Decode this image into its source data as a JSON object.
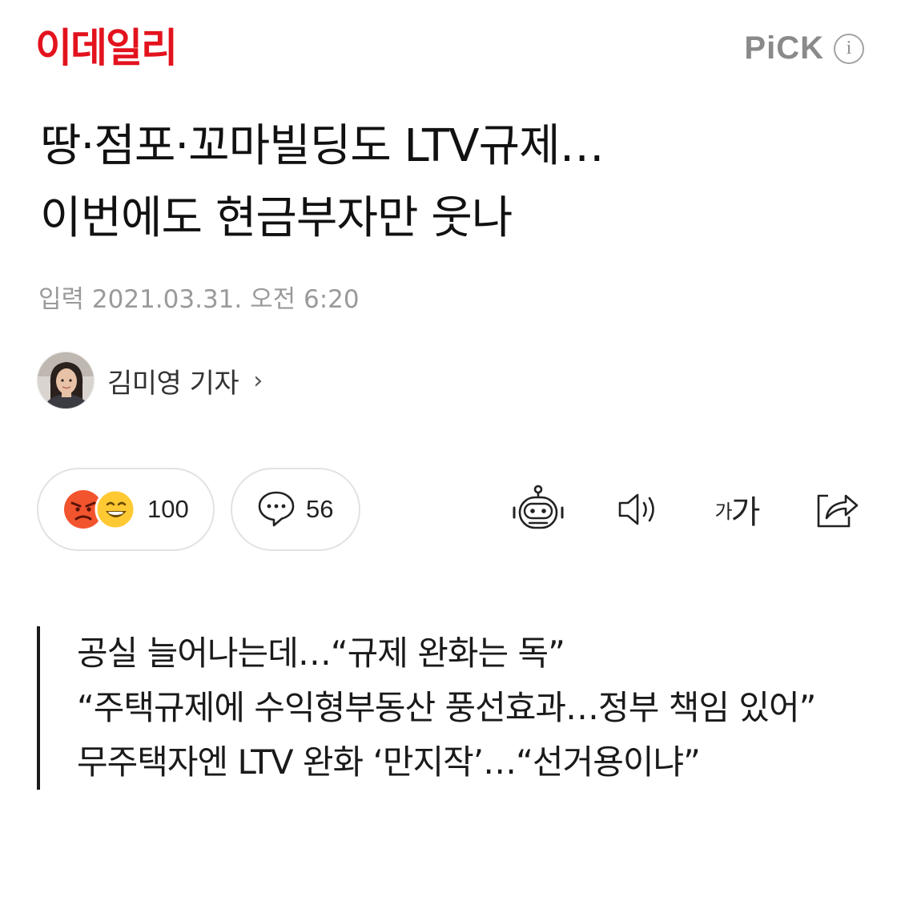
{
  "header": {
    "logo_text": "이데일리",
    "pick_label": "PiCK",
    "info_icon": "i",
    "brand_color": "#e3131e"
  },
  "article": {
    "headline_line1": "땅·점포·꼬마빌딩도 LTV규제…",
    "headline_line2": "이번에도 현금부자만 웃나",
    "timestamp": "입력 2021.03.31. 오전 6:20",
    "author": "김미영 기자",
    "author_chevron": "›"
  },
  "actions": {
    "reaction_count": "100",
    "comment_count": "56",
    "reaction_icons": [
      "angry-face-icon",
      "grinning-face-icon"
    ],
    "tools": [
      "robot-summary-icon",
      "speaker-icon",
      "font-size-icon",
      "share-icon"
    ],
    "font_size_label_small": "가",
    "font_size_label_large": "가"
  },
  "summary": {
    "lines": [
      "공실 늘어나는데…“규제 완화는 독”",
      "“주택규제에 수익형부동산 풍선효과…정부 책임 있어”",
      "무주택자엔 LTV 완화 ‘만지작’…“선거용이냐”"
    ]
  }
}
